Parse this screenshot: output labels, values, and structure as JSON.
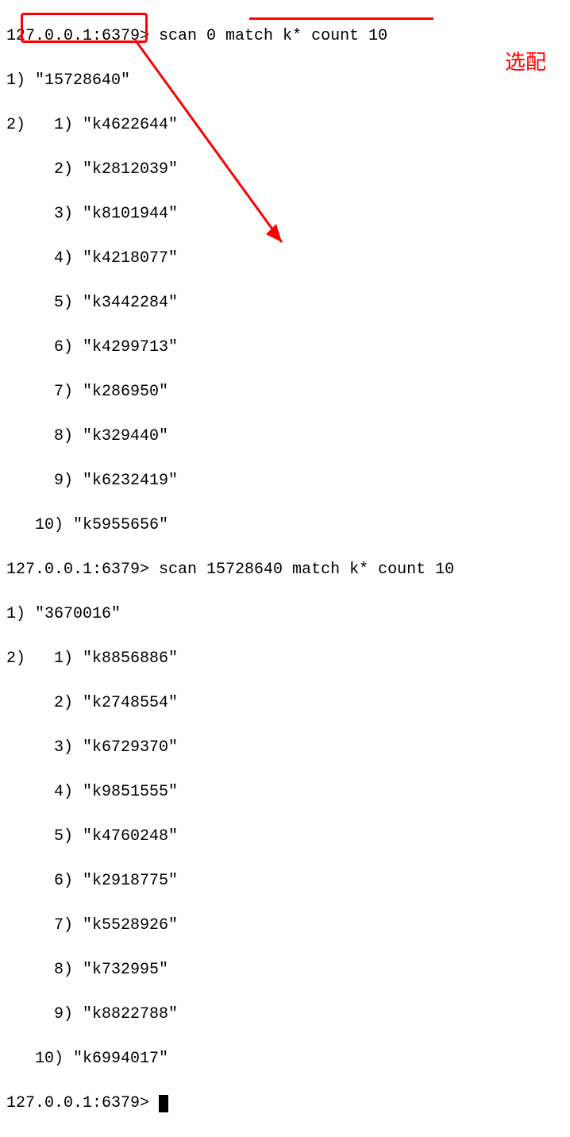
{
  "annotation": {
    "label": "选配"
  },
  "prompt1": "127.0.0.1:6379> ",
  "command1": "scan 0 match k* count 10",
  "result1": {
    "cursor_line": "1) \"15728640\"",
    "list_header": "2)  ",
    "items": [
      " 1) \"k4622644\"",
      " 2) \"k2812039\"",
      " 3) \"k8101944\"",
      " 4) \"k4218077\"",
      " 5) \"k3442284\"",
      " 6) \"k4299713\"",
      " 7) \"k286950\"",
      " 8) \"k329440\"",
      " 9) \"k6232419\"",
      "10) \"k5955656\""
    ]
  },
  "prompt2": "127.0.0.1:6379> ",
  "command2": "scan 15728640 match k* count 10",
  "result2": {
    "cursor_line": "1) \"3670016\"",
    "list_header": "2)  ",
    "items": [
      " 1) \"k8856886\"",
      " 2) \"k2748554\"",
      " 3) \"k6729370\"",
      " 4) \"k9851555\"",
      " 5) \"k4760248\"",
      " 6) \"k2918775\"",
      " 7) \"k5528926\"",
      " 8) \"k732995\"",
      " 9) \"k8822788\"",
      "10) \"k6994017\""
    ]
  },
  "prompt3": "127.0.0.1:6379> "
}
